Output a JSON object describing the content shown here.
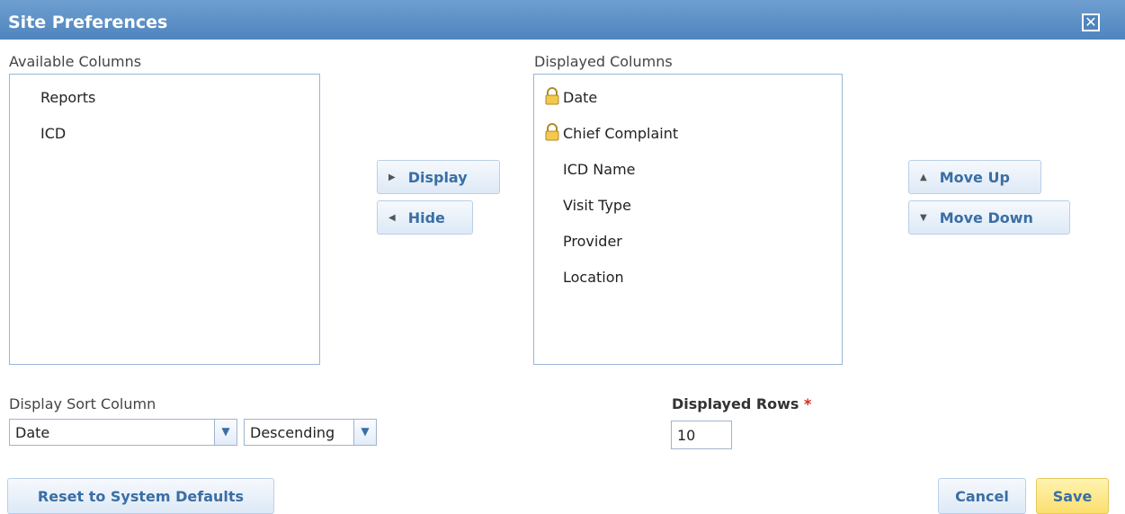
{
  "dialog": {
    "title": "Site Preferences",
    "close_icon": "close-icon"
  },
  "available": {
    "label": "Available Columns",
    "items": [
      "Reports",
      "ICD"
    ]
  },
  "displayed": {
    "label": "Displayed Columns",
    "items": [
      {
        "label": "Date",
        "locked": true
      },
      {
        "label": "Chief Complaint",
        "locked": true
      },
      {
        "label": "ICD Name",
        "locked": false
      },
      {
        "label": "Visit Type",
        "locked": false
      },
      {
        "label": "Provider",
        "locked": false
      },
      {
        "label": "Location",
        "locked": false
      }
    ]
  },
  "transfer": {
    "display_label": "Display",
    "hide_label": "Hide"
  },
  "order": {
    "move_up_label": "Move Up",
    "move_down_label": "Move Down"
  },
  "sort": {
    "label": "Display Sort Column",
    "column_value": "Date",
    "direction_value": "Descending"
  },
  "rows": {
    "label": "Displayed Rows",
    "required_mark": "*",
    "value": "10"
  },
  "footer": {
    "reset_label": "Reset to System Defaults",
    "cancel_label": "Cancel",
    "save_label": "Save"
  },
  "colors": {
    "title_bar": "#5a8cc4",
    "accent_text": "#3a6ea5",
    "save_bg": "#fde98a",
    "required": "#d9261c"
  }
}
